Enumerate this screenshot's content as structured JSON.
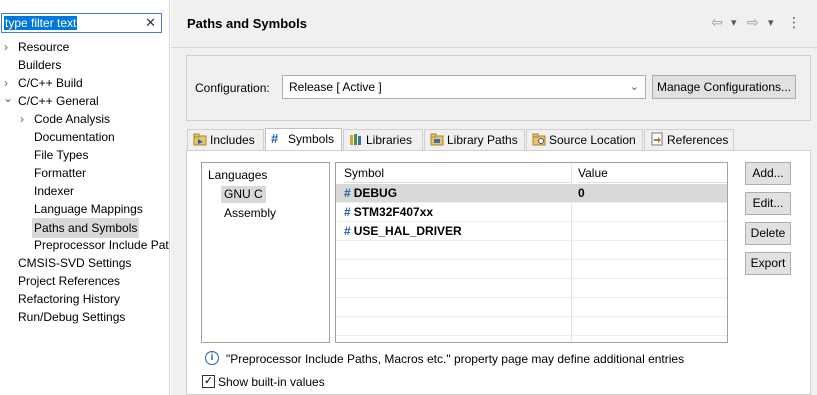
{
  "filter": {
    "value": "type filter text",
    "clear_icon": "✕"
  },
  "tree": [
    {
      "label": "Resource",
      "expander": "›",
      "level": 0
    },
    {
      "label": "Builders",
      "expander": "",
      "level": 0
    },
    {
      "label": "C/C++ Build",
      "expander": "›",
      "level": 0
    },
    {
      "label": "C/C++ General",
      "expander": "⌄",
      "level": 0
    },
    {
      "label": "Code Analysis",
      "expander": "›",
      "level": 1
    },
    {
      "label": "Documentation",
      "expander": "",
      "level": 1
    },
    {
      "label": "File Types",
      "expander": "",
      "level": 1
    },
    {
      "label": "Formatter",
      "expander": "",
      "level": 1
    },
    {
      "label": "Indexer",
      "expander": "",
      "level": 1
    },
    {
      "label": "Language Mappings",
      "expander": "",
      "level": 1
    },
    {
      "label": "Paths and Symbols",
      "expander": "",
      "level": 1,
      "selected": true
    },
    {
      "label": "Preprocessor Include Pat",
      "expander": "",
      "level": 1
    },
    {
      "label": "CMSIS-SVD Settings",
      "expander": "",
      "level": 0
    },
    {
      "label": "Project References",
      "expander": "",
      "level": 0
    },
    {
      "label": "Refactoring History",
      "expander": "",
      "level": 0
    },
    {
      "label": "Run/Debug Settings",
      "expander": "",
      "level": 0
    }
  ],
  "header": {
    "title": "Paths and Symbols",
    "back_icon": "⇦",
    "forward_icon": "⇨",
    "menu_caret": "▾",
    "more_icon": "⋮"
  },
  "configuration": {
    "label": "Configuration:",
    "selected": "Release  [ Active ]",
    "caret": "⌄",
    "manage_button": "Manage Configurations..."
  },
  "tabs": [
    {
      "label": "Includes",
      "icon": "includes-icon"
    },
    {
      "label": "Symbols",
      "icon": "hash-icon",
      "active": true
    },
    {
      "label": "Libraries",
      "icon": "libraries-icon"
    },
    {
      "label": "Library Paths",
      "icon": "library-paths-icon"
    },
    {
      "label": "Source Location",
      "icon": "source-location-icon"
    },
    {
      "label": "References",
      "icon": "references-icon"
    }
  ],
  "languages": {
    "header": "Languages",
    "items": [
      "GNU C",
      "Assembly"
    ]
  },
  "symbols": {
    "columns": [
      "Symbol",
      "Value"
    ],
    "rows": [
      {
        "name": "DEBUG",
        "value": "0",
        "selected": true
      },
      {
        "name": "STM32F407xx",
        "value": ""
      },
      {
        "name": "USE_HAL_DRIVER",
        "value": ""
      }
    ]
  },
  "buttons": {
    "add": "Add...",
    "edit": "Edit...",
    "delete": "Delete",
    "export": "Export"
  },
  "footer": {
    "info": "\"Preprocessor Include Paths, Macros etc.\" property page may define additional entries",
    "show_builtin": "Show built-in values",
    "show_builtin_checked": true
  },
  "colors": {
    "accent": "#0078d7",
    "hash": "#1a5fb4",
    "selection": "#d9d9d9"
  }
}
